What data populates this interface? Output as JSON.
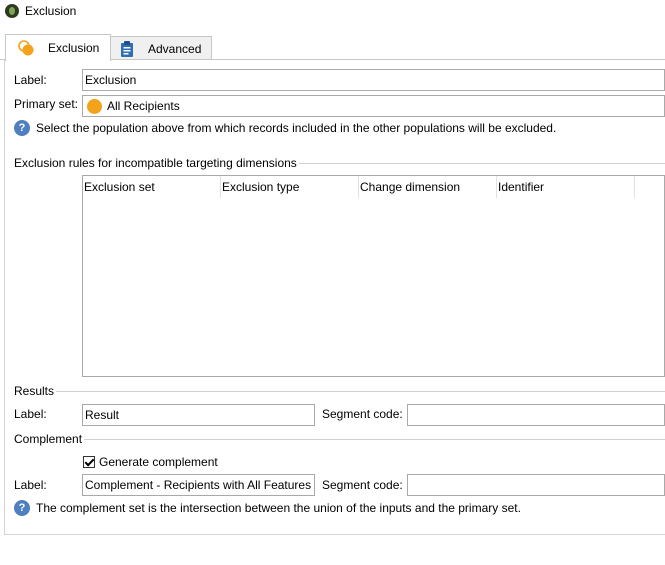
{
  "window": {
    "title": "Exclusion"
  },
  "tabs": [
    {
      "label": "Exclusion",
      "active": true
    },
    {
      "label": "Advanced",
      "active": false
    }
  ],
  "main": {
    "label_caption": "Label:",
    "label_value": "Exclusion",
    "primary_set_caption": "Primary set:",
    "primary_set_value": "All Recipients",
    "help_text_1": "Select the population above from which records included in the other populations will be excluded."
  },
  "rules": {
    "title": "Exclusion rules for incompatible targeting dimensions",
    "columns": [
      "Exclusion set",
      "Exclusion type",
      "Change dimension",
      "Identifier"
    ],
    "rows": []
  },
  "results": {
    "title": "Results",
    "label_caption": "Label:",
    "label_value": "Result",
    "segment_caption": "Segment code:",
    "segment_value": ""
  },
  "complement": {
    "title": "Complement",
    "generate_label": "Generate complement",
    "generate_checked": true,
    "label_caption": "Label:",
    "label_value": "Complement - Recipients with All Features",
    "segment_caption": "Segment code:",
    "segment_value": "",
    "help_text_2": "The complement set is the intersection between the union of the inputs and the primary set."
  },
  "colors": {
    "accent_orange": "#f3a21b",
    "help_blue": "#4f7fbf",
    "border_gray": "#a9a9a9"
  },
  "icons": {
    "window": "workflow-icon",
    "tab_exclusion": "exclusion-venn-icon",
    "tab_advanced": "clipboard-icon",
    "primary_set": "orange-circle-icon",
    "help": "help-icon"
  }
}
